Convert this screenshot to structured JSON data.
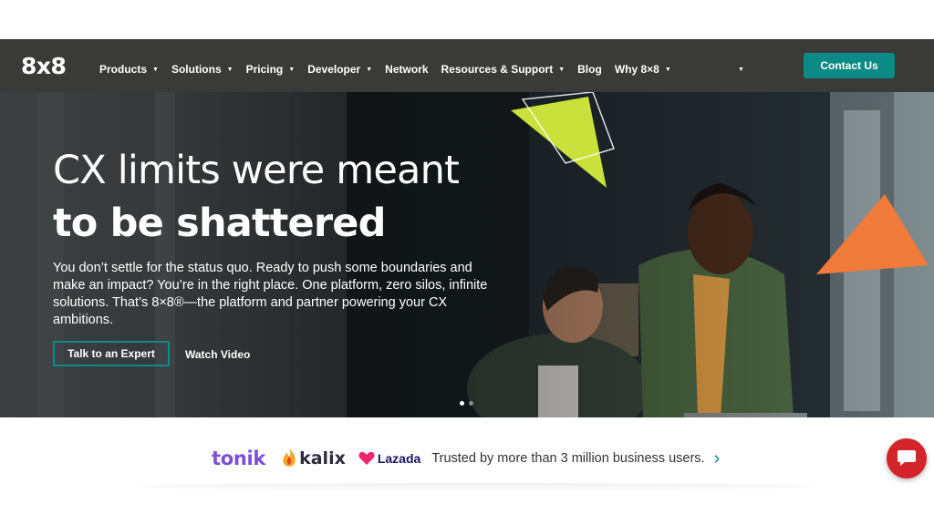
{
  "nav": {
    "logo": "8x8",
    "items": [
      {
        "label": "Products",
        "caret": true
      },
      {
        "label": "Solutions",
        "caret": true
      },
      {
        "label": "Pricing",
        "caret": true
      },
      {
        "label": "Developer",
        "caret": true
      },
      {
        "label": "Network",
        "caret": false
      },
      {
        "label": "Resources & Support",
        "caret": true
      },
      {
        "label": "Blog",
        "caret": false
      },
      {
        "label": "Why 8×8",
        "caret": true
      }
    ],
    "contact_label": "Contact Us"
  },
  "hero": {
    "headline_line1": "CX limits were meant",
    "headline_line2": "to be shattered",
    "description": "You don’t settle for the status quo. Ready to push some boundaries and make an impact? You’re in the right place. One platform, zero silos, infinite solutions. That’s 8×8®—the platform and partner powering your CX ambitions.",
    "cta_primary": "Talk to an Expert",
    "cta_secondary": "Watch Video",
    "slide_count": 2,
    "active_slide": 1
  },
  "trust_bar": {
    "logos": [
      "tonik",
      "kalix",
      "Lazada"
    ],
    "text": "Trusted by more than 3 million business users."
  },
  "colors": {
    "nav_bg": "#3a3a38",
    "accent_teal": "#0b8a86",
    "lime_shape": "#c9e13a",
    "orange_shape": "#f07a3a",
    "chat_red": "#d3242a"
  },
  "icons": {
    "next": "chevron-right-icon",
    "chat": "chat-bubble-icon"
  }
}
